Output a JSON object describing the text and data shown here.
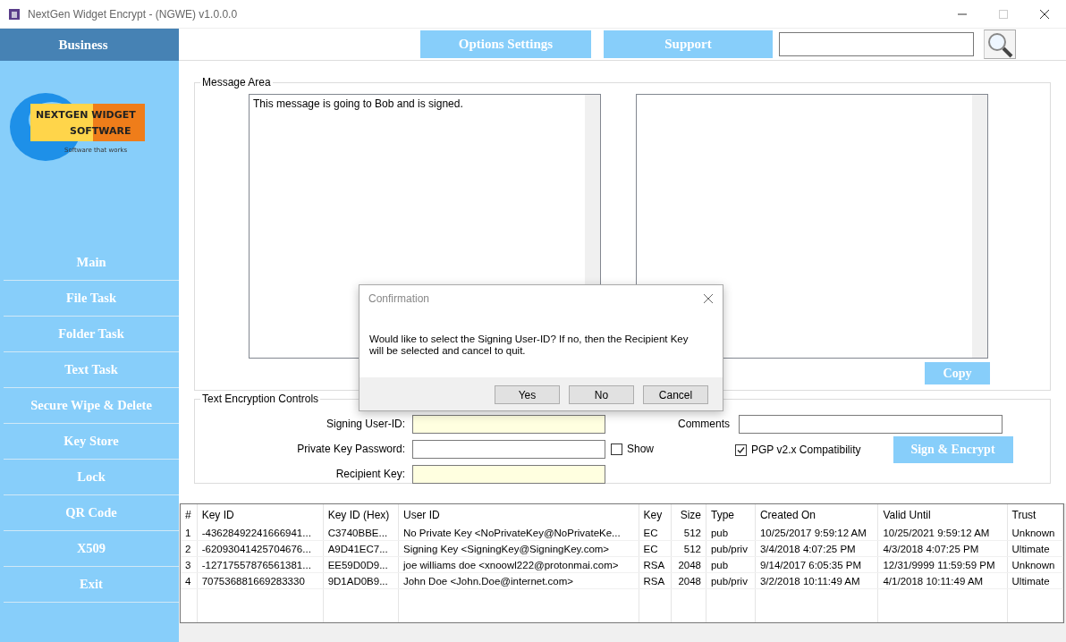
{
  "window": {
    "title": "NextGen Widget Encrypt - (NGWE) v1.0.0.0"
  },
  "header": {
    "buttons": [
      "Options Settings",
      "Support"
    ]
  },
  "sidebar": {
    "title": "Business",
    "logo": {
      "line_1": "NEXTGEN WIDGET",
      "line_2": "SOFTWARE",
      "tagline": "Software that works"
    },
    "items": [
      "Main",
      "File Task",
      "Folder Task",
      "Text Task",
      "Secure Wipe & Delete",
      "Key Store",
      "Lock",
      "QR Code",
      "X509",
      "Exit"
    ]
  },
  "message_area": {
    "title": "Message Area",
    "input": "This message is going to Bob and is signed.",
    "copy_button": "Copy"
  },
  "controls": {
    "title": "Text Encryption Controls",
    "fields": [
      {
        "label": "Signing User-ID:",
        "highlighted": true
      },
      {
        "label": "Private Key Password:",
        "highlighted": false
      },
      {
        "label": "Recipient Key:",
        "highlighted": true
      }
    ],
    "show": {
      "label": "Show",
      "checked": false
    },
    "comments_label": "Comments",
    "pgp": {
      "label": "PGP v2.x Compatibility",
      "checked": true
    },
    "sign_button": "Sign & Encrypt"
  },
  "table": {
    "columns": [
      "#",
      "Key ID",
      "Key ID (Hex)",
      "User ID",
      "Key",
      "Size",
      "Type",
      "Created On",
      "Valid Until",
      "Trust"
    ],
    "rows": [
      [
        "1",
        "-43628492241666941...",
        "C3740BBE...",
        "No Private Key <NoPrivateKey@NoPrivateKe...",
        "EC",
        "512",
        "pub",
        "10/25/2017 9:59:12 AM",
        "10/25/2021 9:59:12 AM",
        "Unknown"
      ],
      [
        "2",
        "-62093041425704676...",
        "A9D41EC7...",
        "Signing Key <SigningKey@SigningKey.com>",
        "EC",
        "512",
        "pub/priv",
        "3/4/2018 4:07:25 PM",
        "4/3/2018 4:07:25 PM",
        "Ultimate"
      ],
      [
        "3",
        "-12717557876561381...",
        "EE59D0D9...",
        "joe williams doe <xnoowl222@protonmai.com>",
        "RSA",
        "2048",
        "pub",
        "9/14/2017 6:05:35 PM",
        "12/31/9999 11:59:59 PM",
        "Unknown"
      ],
      [
        "4",
        "707536881669283330",
        "9D1AD0B9...",
        "John Doe <John.Doe@internet.com>",
        "RSA",
        "2048",
        "pub/priv",
        "3/2/2018 10:11:49 AM",
        "4/1/2018 10:11:49 AM",
        "Ultimate"
      ]
    ]
  },
  "dialog": {
    "title": "Confirmation",
    "message": "Would like to select the Signing User-ID? If no, then the Recipient Key will be selected and cancel to quit.",
    "buttons": [
      "Yes",
      "No",
      "Cancel"
    ]
  }
}
